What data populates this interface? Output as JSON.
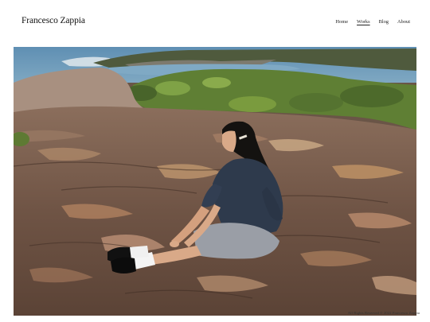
{
  "header": {
    "site_title": "Francesco Zappia",
    "nav": [
      {
        "label": "Home",
        "active": false
      },
      {
        "label": "Works",
        "active": true
      },
      {
        "label": "Blog",
        "active": false
      },
      {
        "label": "About",
        "active": false
      }
    ]
  },
  "main": {
    "photo_subject": "person-sitting-on-coastal-rock-photo"
  },
  "footer": {
    "credit": "All Rights Reserved © 2022 Francesco Zappia"
  },
  "colors": {
    "background": "#ffffff",
    "text": "#111111",
    "sea": "#5d8fb0",
    "vegetation": "#6b8f3a",
    "rock": "#7a5f4e"
  }
}
